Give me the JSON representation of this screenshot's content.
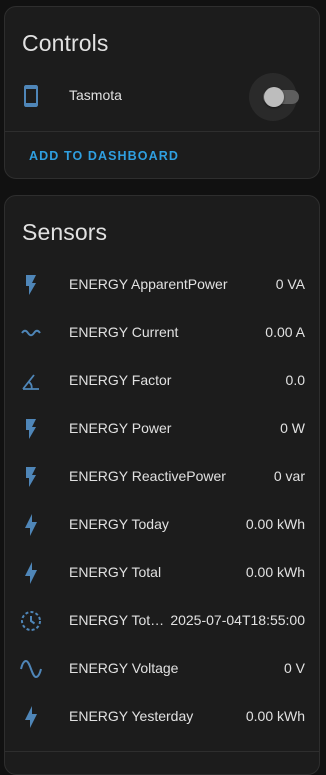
{
  "colors": {
    "background": "#111111",
    "card": "#1c1c1c",
    "accent": "#2f9fe0",
    "icon": "#4f86b8",
    "text": "#e1e1e1"
  },
  "controls": {
    "title": "Controls",
    "items": [
      {
        "icon": "cellphone-icon",
        "label": "Tasmota",
        "state": "off"
      }
    ],
    "add_button_label": "ADD TO DASHBOARD"
  },
  "sensors": {
    "title": "Sensors",
    "items": [
      {
        "icon": "flash-icon",
        "label": "ENERGY ApparentPower",
        "value": "0 VA"
      },
      {
        "icon": "current-ac-icon",
        "label": "ENERGY Current",
        "value": "0.00 A"
      },
      {
        "icon": "angle-acute-icon",
        "label": "ENERGY Factor",
        "value": "0.0"
      },
      {
        "icon": "flash-icon",
        "label": "ENERGY Power",
        "value": "0 W"
      },
      {
        "icon": "flash-icon",
        "label": "ENERGY ReactivePower",
        "value": "0 var"
      },
      {
        "icon": "lightning-bolt-icon",
        "label": "ENERGY Today",
        "value": "0.00 kWh"
      },
      {
        "icon": "lightning-bolt-icon",
        "label": "ENERGY Total",
        "value": "0.00 kWh"
      },
      {
        "icon": "clock-outline-icon",
        "label": "ENERGY Tot…",
        "value": "2025-07-04T18:55:00"
      },
      {
        "icon": "sine-wave-icon",
        "label": "ENERGY Voltage",
        "value": "0 V"
      },
      {
        "icon": "lightning-bolt-icon",
        "label": "ENERGY Yesterday",
        "value": "0.00 kWh"
      }
    ]
  }
}
